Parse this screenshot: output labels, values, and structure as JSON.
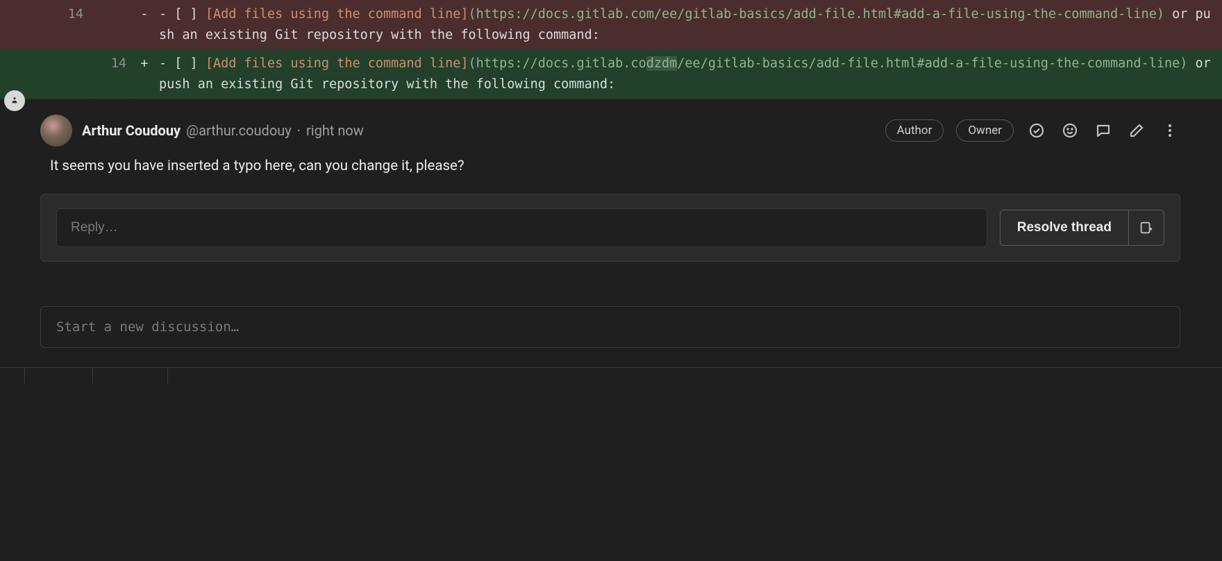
{
  "diff": {
    "removed": {
      "old_line": "14",
      "new_line": "",
      "sign": "-",
      "prefix": "- [ ] ",
      "link_text_open": "[",
      "link_text": "Add files using the command line",
      "link_text_close": "]",
      "url_open": "(",
      "url_part1": "https://docs.gitlab.co",
      "url_changed": "m",
      "url_part2": "/ee/gitlab-basics/add-file.html#add-a-file-using-the-command-line",
      "url_close": ")",
      "suffix": " or push an existing Git repository with the following command:"
    },
    "added": {
      "old_line": "",
      "new_line": "14",
      "sign": "+",
      "prefix": "- [ ] ",
      "link_text_open": "[",
      "link_text": "Add files using the command line",
      "link_text_close": "]",
      "url_open": "(",
      "url_part1": "https://docs.gitlab.co",
      "url_changed": "dzdm",
      "url_part2": "/ee/gitlab-basics/add-file.html#add-a-file-using-the-command-line",
      "url_close": ")",
      "suffix": " or push an existing Git repository with the following command:"
    }
  },
  "comment": {
    "author_name": "Arthur Coudouy",
    "author_handle": "@arthur.coudouy",
    "sep": "·",
    "time": "right now",
    "badges": {
      "author": "Author",
      "owner": "Owner"
    },
    "body": "It seems you have inserted a typo here, can you change it, please?",
    "reply_placeholder": "Reply…",
    "resolve_label": "Resolve thread"
  },
  "new_discussion_placeholder": "Start a new discussion…"
}
